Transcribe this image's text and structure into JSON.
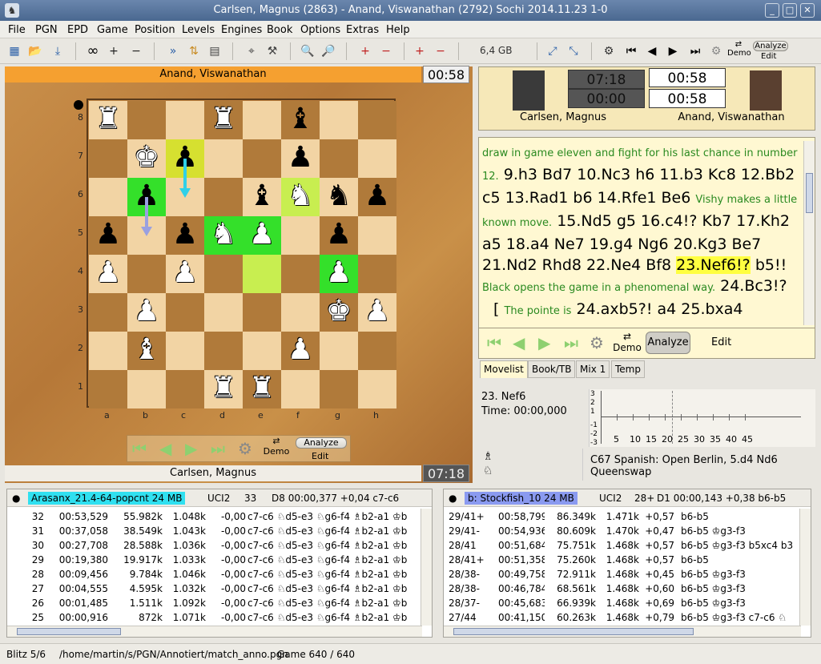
{
  "window": {
    "title": "Carlsen, Magnus (2863)  -  Anand, Viswanathan (2792)    Sochi     2014.11.23     1-0"
  },
  "menu": [
    "File",
    "PGN",
    "EPD",
    "Game",
    "Position",
    "Levels",
    "Engines",
    "Book",
    "Options",
    "Extras",
    "Help"
  ],
  "toolbar": {
    "memory": "6,4 GB",
    "lev": "LEV",
    "pgn": "PGN",
    "epd": "EPD",
    "demo": "Demo",
    "analyze": "Analyze",
    "edit": "Edit"
  },
  "board": {
    "top_player": "Anand, Viswanathan",
    "top_clock": "00:58",
    "bottom_player": "Carlsen, Magnus",
    "bottom_clock": "07:18",
    "files": [
      "a",
      "b",
      "c",
      "d",
      "e",
      "f",
      "g",
      "h"
    ],
    "ranks": [
      "8",
      "7",
      "6",
      "5",
      "4",
      "3",
      "2",
      "1"
    ],
    "nav": {
      "demo": "Demo",
      "analyze": "Analyze",
      "edit": "Edit"
    },
    "pieces": [
      {
        "sq": "a8",
        "g": "♜",
        "c": "w"
      },
      {
        "sq": "d8",
        "g": "♜",
        "c": "w"
      },
      {
        "sq": "f8",
        "g": "♝",
        "c": "b"
      },
      {
        "sq": "b7",
        "g": "♚",
        "c": "w"
      },
      {
        "sq": "c7",
        "g": "♟",
        "c": "b"
      },
      {
        "sq": "f7",
        "g": "♟",
        "c": "b"
      },
      {
        "sq": "b6",
        "g": "♟",
        "c": "b"
      },
      {
        "sq": "e6",
        "g": "♝",
        "c": "b"
      },
      {
        "sq": "f6",
        "g": "♞",
        "c": "w"
      },
      {
        "sq": "g6",
        "g": "♞",
        "c": "b"
      },
      {
        "sq": "h6",
        "g": "♟",
        "c": "b"
      },
      {
        "sq": "a5",
        "g": "♟",
        "c": "b"
      },
      {
        "sq": "c5",
        "g": "♟",
        "c": "b"
      },
      {
        "sq": "d5",
        "g": "♞",
        "c": "w"
      },
      {
        "sq": "e5",
        "g": "♟",
        "c": "w"
      },
      {
        "sq": "g5",
        "g": "♟",
        "c": "b"
      },
      {
        "sq": "a4",
        "g": "♟",
        "c": "w"
      },
      {
        "sq": "c4",
        "g": "♟",
        "c": "w"
      },
      {
        "sq": "g4",
        "g": "♟",
        "c": "w"
      },
      {
        "sq": "b3",
        "g": "♟",
        "c": "w"
      },
      {
        "sq": "g3",
        "g": "♚",
        "c": "w"
      },
      {
        "sq": "h3",
        "g": "♟",
        "c": "w"
      },
      {
        "sq": "b2",
        "g": "♝",
        "c": "w"
      },
      {
        "sq": "f2",
        "g": "♟",
        "c": "w"
      },
      {
        "sq": "d1",
        "g": "♜",
        "c": "w"
      },
      {
        "sq": "e1",
        "g": "♜",
        "c": "w"
      }
    ],
    "highlights": [
      {
        "sq": "b6",
        "t": "hlg"
      },
      {
        "sq": "c7",
        "t": "hly"
      },
      {
        "sq": "f6",
        "t": "hlyl"
      },
      {
        "sq": "d5",
        "t": "hlg"
      },
      {
        "sq": "e5",
        "t": "hlg"
      },
      {
        "sq": "e4",
        "t": "hlyl"
      },
      {
        "sq": "g4",
        "t": "hlg"
      }
    ]
  },
  "players": {
    "white_name": "Carlsen, Magnus",
    "black_name": "Anand, Viswanathan",
    "white_time1": "07:18",
    "white_time2": "00:00",
    "black_time1": "00:58",
    "black_time2": "00:58"
  },
  "notation": {
    "c1": "draw in game eleven and fight for his last chance in number 12.",
    "m1": "9.h3 Bd7 10.Nc3 h6 11.b3 Kc8 12.Bb2 c5 13.Rad1 b6 14.Rfe1 Be6",
    "c2": "Vishy makes a little known move.",
    "m2": "15.Nd5 g5 16.c4!? Kb7 17.Kh2 a5 18.a4 Ne7 19.g4 Ng6 20.Kg3 Be7 21.Nd2 Rhd8 22.Ne4 Bf8",
    "current": "23.Nef6!?",
    "m3": "b5!!",
    "c3": "Black opens the game in a phenomenal way.",
    "m4": "24.Bc3!?",
    "bracket": "[",
    "c4": "The pointe is",
    "m5": "24.axb5?! a4 25.bxa4"
  },
  "nav2": {
    "demo": "Demo",
    "analyze": "Analyze",
    "edit": "Edit"
  },
  "tabs": [
    "Movelist",
    "Book/TB",
    "Mix 1",
    "Temp"
  ],
  "eval": {
    "move": "23. Nef6",
    "time": "Time: 00:00,000",
    "yticks": [
      "3",
      "2",
      "1",
      "-1",
      "-2",
      "-3"
    ],
    "xticks": [
      "5",
      "10",
      "15",
      "20",
      "25",
      "30",
      "35",
      "40",
      "45"
    ]
  },
  "opening": {
    "code_name": "C67  Spanish: Open Berlin, 5.d4 Nd6",
    "variation": "Queenswap"
  },
  "engine1": {
    "name": "Arasanx_21.4-64-popcnt  24 MB",
    "color": "#30e0f0",
    "proto": "UCI2",
    "depth": "33",
    "summary": "D8  00:00,377  +0,04   c7-c6",
    "rows": [
      [
        "32",
        "00:53,529",
        "55.982k",
        "1.048k",
        "-0,00",
        "c7-c6 ♘d5-e3 ♘g6-f4 ♗b2-a1 ♔b"
      ],
      [
        "31",
        "00:37,058",
        "38.549k",
        "1.043k",
        "-0,00",
        "c7-c6 ♘d5-e3 ♘g6-f4 ♗b2-a1 ♔b"
      ],
      [
        "30",
        "00:27,708",
        "28.588k",
        "1.036k",
        "-0,00",
        "c7-c6 ♘d5-e3 ♘g6-f4 ♗b2-a1 ♔b"
      ],
      [
        "29",
        "00:19,380",
        "19.917k",
        "1.033k",
        "-0,00",
        "c7-c6 ♘d5-e3 ♘g6-f4 ♗b2-a1 ♔b"
      ],
      [
        "28",
        "00:09,456",
        "9.784k",
        "1.046k",
        "-0,00",
        "c7-c6 ♘d5-e3 ♘g6-f4 ♗b2-a1 ♔b"
      ],
      [
        "27",
        "00:04,555",
        "4.595k",
        "1.032k",
        "-0,00",
        "c7-c6 ♘d5-e3 ♘g6-f4 ♗b2-a1 ♔b"
      ],
      [
        "26",
        "00:01,485",
        "1.511k",
        "1.092k",
        "-0,00",
        "c7-c6 ♘d5-e3 ♘g6-f4 ♗b2-a1 ♔b"
      ],
      [
        "25",
        "00:00,916",
        "872k",
        "1.071k",
        "-0,00",
        "c7-c6 ♘d5-e3 ♘g6-f4 ♗b2-a1 ♔b"
      ]
    ]
  },
  "engine2": {
    "name": "b: Stockfish_10  24 MB",
    "color": "#8a9af0",
    "proto": "UCI2",
    "depth": "28+",
    "summary": "D1  00:00,143  +0,38   b6-b5",
    "rows": [
      [
        "29/41+",
        "00:58,799",
        "86.349k",
        "1.471k",
        "+0,57",
        "b6-b5"
      ],
      [
        "29/41-",
        "00:54,936",
        "80.609k",
        "1.470k",
        "+0,47",
        "b6-b5 ♔g3-f3"
      ],
      [
        "28/41",
        "00:51,684",
        "75.751k",
        "1.468k",
        "+0,57",
        "b6-b5 ♔g3-f3 b5xc4 b3"
      ],
      [
        "28/41+",
        "00:51,358",
        "75.260k",
        "1.468k",
        "+0,57",
        "b6-b5"
      ],
      [
        "28/38-",
        "00:49,758",
        "72.911k",
        "1.468k",
        "+0,45",
        "b6-b5 ♔g3-f3"
      ],
      [
        "28/38-",
        "00:46,784",
        "68.561k",
        "1.468k",
        "+0,60",
        "b6-b5 ♔g3-f3"
      ],
      [
        "28/37-",
        "00:45,683",
        "66.939k",
        "1.468k",
        "+0,69",
        "b6-b5 ♔g3-f3"
      ],
      [
        "27/44",
        "00:41,150",
        "60.263k",
        "1.468k",
        "+0,79",
        "b6-b5 ♔g3-f3 c7-c6 ♘"
      ]
    ]
  },
  "status": {
    "level": "Blitz 5/6",
    "file": "/home/martin/s/PGN/Annotiert/match_anno.pgn",
    "game": "Game 640 / 640"
  }
}
